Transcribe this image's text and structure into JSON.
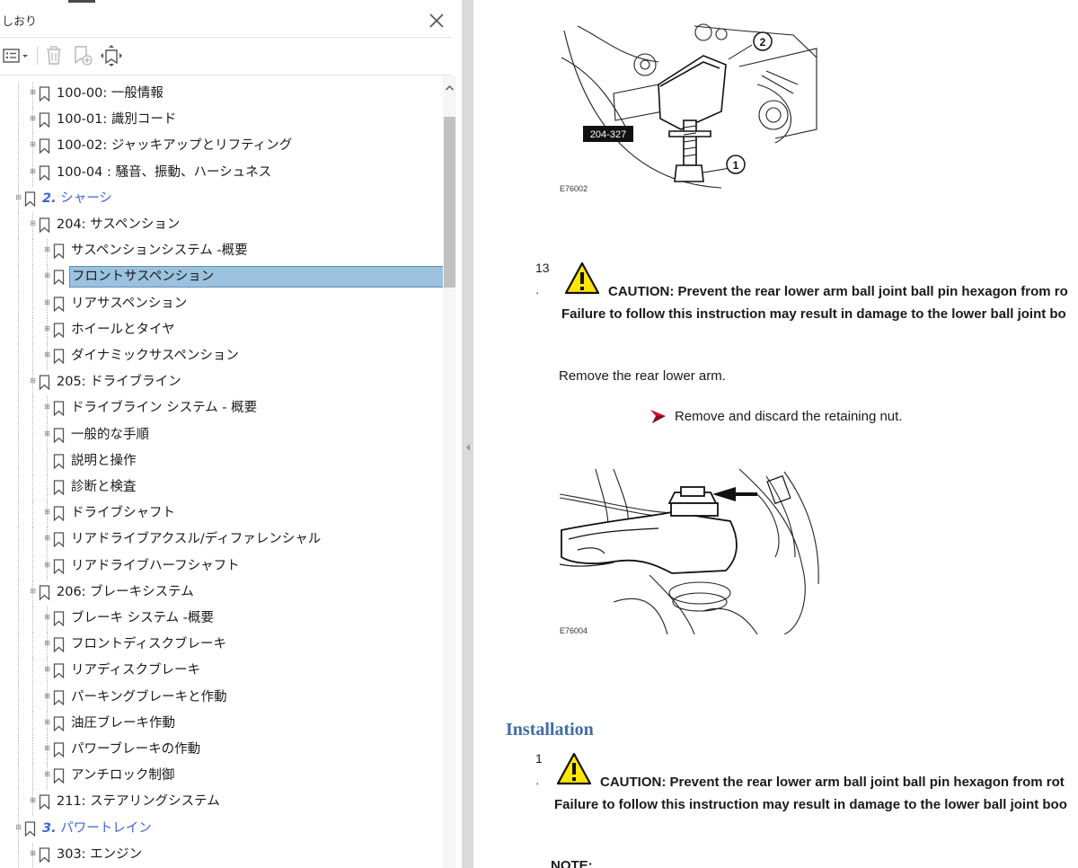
{
  "panel": {
    "title": "しおり"
  },
  "icons": {
    "close": "close-icon",
    "options": "list-options-icon",
    "delete": "trash-icon",
    "new_bookmark": "new-bookmark-icon",
    "expand": "bookmark-expand-icon"
  },
  "bookmarks": [
    {
      "label": "100-00: 一般情報",
      "level": 1,
      "toggle": "+",
      "section": false
    },
    {
      "label": "100-01: 識別コード",
      "level": 1,
      "toggle": "+",
      "section": false
    },
    {
      "label": "100-02: ジャッキアップとリフティング",
      "level": 1,
      "toggle": "+",
      "section": false
    },
    {
      "label": "100-04 : 騒音、振動、ハーシュネス",
      "level": 1,
      "toggle": "+",
      "section": false
    },
    {
      "label": "2. シャーシ",
      "level": 0,
      "toggle": "-",
      "section": true
    },
    {
      "label": "204: サスペンション",
      "level": 1,
      "toggle": "-",
      "section": false
    },
    {
      "label": "サスペンションシステム -概要",
      "level": 2,
      "toggle": "+",
      "section": false
    },
    {
      "label": "フロントサスペンション",
      "level": 2,
      "toggle": "+",
      "section": false,
      "selected": true
    },
    {
      "label": "リアサスペンション",
      "level": 2,
      "toggle": "+",
      "section": false
    },
    {
      "label": "ホイールとタイヤ",
      "level": 2,
      "toggle": "+",
      "section": false
    },
    {
      "label": "ダイナミックサスペンション",
      "level": 2,
      "toggle": "+",
      "section": false
    },
    {
      "label": "205: ドライブライン",
      "level": 1,
      "toggle": "-",
      "section": false
    },
    {
      "label": "ドライブライン システム - 概要",
      "level": 2,
      "toggle": "+",
      "section": false
    },
    {
      "label": "一般的な手順",
      "level": 2,
      "toggle": "+",
      "section": false
    },
    {
      "label": "説明と操作",
      "level": 2,
      "toggle": "",
      "section": false
    },
    {
      "label": "診断と検査",
      "level": 2,
      "toggle": "",
      "section": false
    },
    {
      "label": "ドライブシャフト",
      "level": 2,
      "toggle": "+",
      "section": false
    },
    {
      "label": "リアドライブアクスル/ディファレンシャル",
      "level": 2,
      "toggle": "+",
      "section": false
    },
    {
      "label": " リアドライブハーフシャフト",
      "level": 2,
      "toggle": "+",
      "section": false
    },
    {
      "label": "206: ブレーキシステム",
      "level": 1,
      "toggle": "-",
      "section": false
    },
    {
      "label": "ブレーキ システム -概要",
      "level": 2,
      "toggle": "+",
      "section": false
    },
    {
      "label": "フロントディスクブレーキ",
      "level": 2,
      "toggle": "+",
      "section": false
    },
    {
      "label": "リアディスクブレーキ",
      "level": 2,
      "toggle": "+",
      "section": false
    },
    {
      "label": "パーキングブレーキと作動",
      "level": 2,
      "toggle": "+",
      "section": false
    },
    {
      "label": "油圧ブレーキ作動",
      "level": 2,
      "toggle": "+",
      "section": false
    },
    {
      "label": "パワーブレーキの作動",
      "level": 2,
      "toggle": "+",
      "section": false
    },
    {
      "label": "アンチロック制御",
      "level": 2,
      "toggle": "+",
      "section": false
    },
    {
      "label": "211: ステアリングシステム",
      "level": 1,
      "toggle": "+",
      "section": false
    },
    {
      "label": "3. パワートレイン",
      "level": 0,
      "toggle": "-",
      "section": true
    },
    {
      "label": "303: エンジン",
      "level": 1,
      "toggle": "+",
      "section": false
    }
  ],
  "document": {
    "figure1": {
      "code": "E76002",
      "tool_label": "204-327",
      "callout1": "1",
      "callout2": "2"
    },
    "step13": {
      "number": "13",
      "bullet": "·",
      "caution_line1": "CAUTION: Prevent the rear lower arm ball joint ball pin hexagon from ro",
      "caution_line2": "Failure to follow this instruction may result in damage to the lower ball joint bo",
      "instruction": "Remove the rear lower arm.",
      "substep": "Remove and discard the retaining nut."
    },
    "figure2": {
      "code": "E76004"
    },
    "installation": {
      "heading": "Installation",
      "number": "1",
      "bullet": "·",
      "caution_line1": "CAUTION: Prevent the rear lower arm ball joint ball pin hexagon from rot",
      "caution_line2": "Failure to follow this instruction may result in damage to the lower ball joint boo",
      "note": "NOTE:"
    }
  },
  "colors": {
    "section_link": "#3c66d6",
    "selected_bg": "#9bc2df",
    "heading": "#3f6ea5",
    "warning_yellow": "#ffe600",
    "arrow_red": "#c8102e"
  }
}
